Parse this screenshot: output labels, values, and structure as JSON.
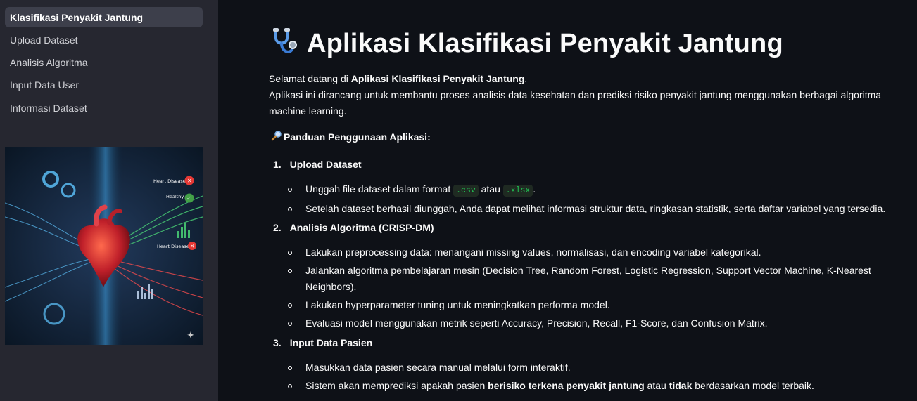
{
  "sidebar": {
    "items": [
      {
        "label": "Klasifikasi Penyakit Jantung",
        "active": true
      },
      {
        "label": "Upload Dataset",
        "active": false
      },
      {
        "label": "Analisis Algoritma",
        "active": false
      },
      {
        "label": "Input Data User",
        "active": false
      },
      {
        "label": "Informasi Dataset",
        "active": false
      }
    ],
    "image_labels": {
      "top": "Heart Disease",
      "mid": "Healthy",
      "bottom": "Heart Disease"
    }
  },
  "main": {
    "title": "Aplikasi Klasifikasi Penyakit Jantung",
    "title_icon": "stethoscope-icon",
    "intro_prefix": "Selamat datang di ",
    "intro_bold": "Aplikasi Klasifikasi Penyakit Jantung",
    "intro_suffix": ".",
    "intro_line2": "Aplikasi ini dirancang untuk membantu proses analisis data kesehatan dan prediksi risiko penyakit jantung menggunakan berbagai algoritma machine learning.",
    "guide_icon": "magnifier-icon",
    "guide_title": "Panduan Penggunaan Aplikasi:",
    "steps": [
      {
        "num": "1.",
        "title": "Upload Dataset",
        "items": [
          {
            "pre": "Unggah file dataset dalam format ",
            "code1": ".csv",
            "mid": " atau ",
            "code2": ".xlsx",
            "post": "."
          },
          {
            "text": "Setelah dataset berhasil diunggah, Anda dapat melihat informasi struktur data, ringkasan statistik, serta daftar variabel yang tersedia."
          }
        ]
      },
      {
        "num": "2.",
        "title": "Analisis Algoritma (CRISP-DM)",
        "items": [
          {
            "text": "Lakukan preprocessing data: menangani missing values, normalisasi, dan encoding variabel kategorikal."
          },
          {
            "text": "Jalankan algoritma pembelajaran mesin (Decision Tree, Random Forest, Logistic Regression, Support Vector Machine, K-Nearest Neighbors)."
          },
          {
            "text": "Lakukan hyperparameter tuning untuk meningkatkan performa model."
          },
          {
            "text": "Evaluasi model menggunakan metrik seperti Accuracy, Precision, Recall, F1-Score, dan Confusion Matrix."
          }
        ]
      },
      {
        "num": "3.",
        "title": "Input Data Pasien",
        "items": [
          {
            "text": "Masukkan data pasien secara manual melalui form interaktif."
          },
          {
            "pre": "Sistem akan memprediksi apakah pasien ",
            "bold1": "berisiko terkena penyakit jantung",
            "mid": " atau ",
            "bold2": "tidak",
            "post": " berdasarkan model terbaik."
          }
        ]
      }
    ]
  }
}
